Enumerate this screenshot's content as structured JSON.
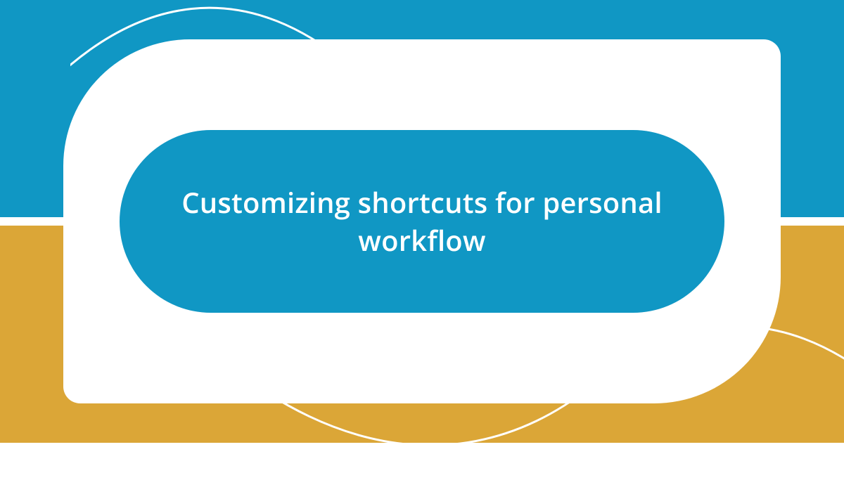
{
  "title": "Customizing shortcuts for personal workflow",
  "colors": {
    "top": "#1097c4",
    "bottom": "#dba637",
    "card": "#ffffff",
    "pill": "#1097c4",
    "text": "#ffffff"
  }
}
